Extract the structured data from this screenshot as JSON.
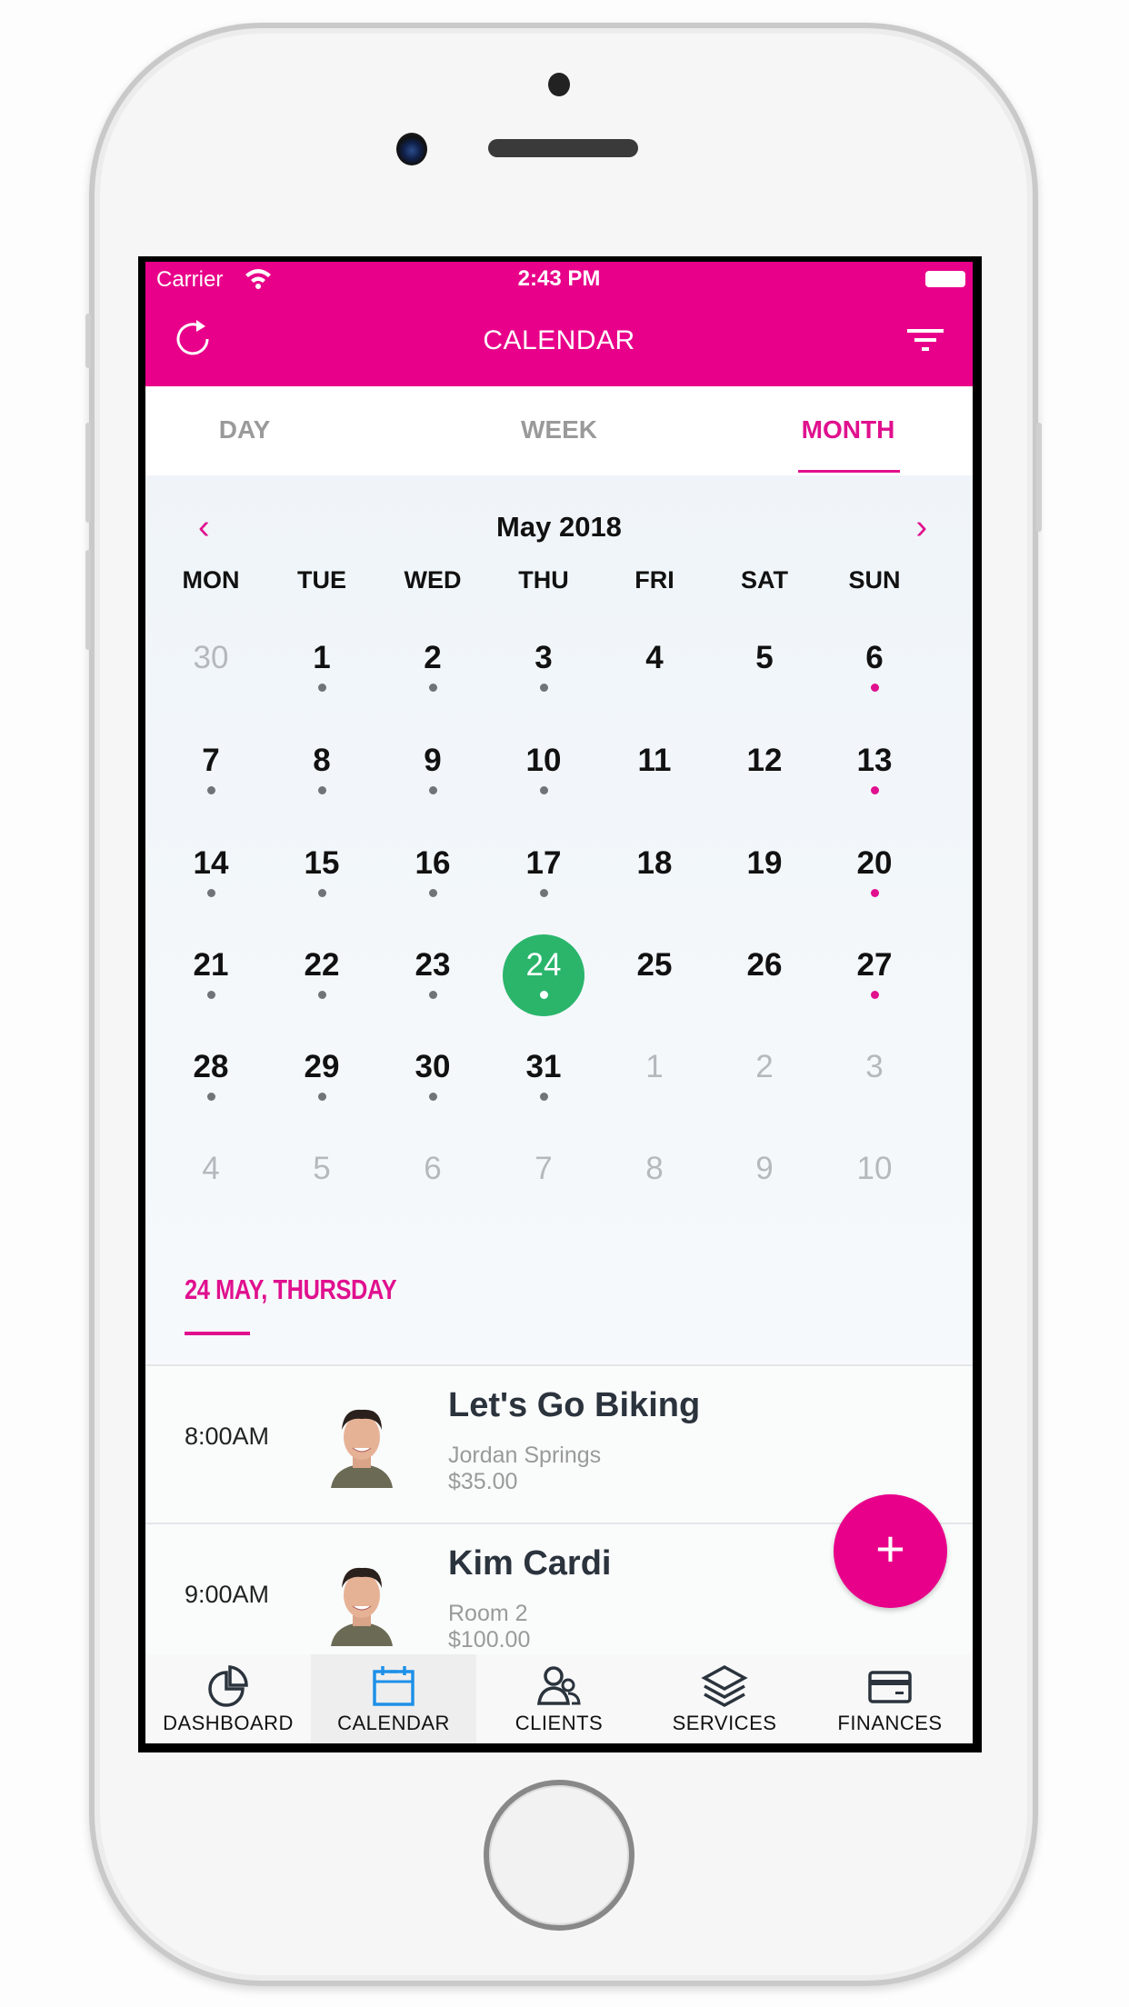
{
  "status_bar": {
    "carrier": "Carrier",
    "time": "2:43 PM"
  },
  "nav": {
    "title": "CALENDAR",
    "left_icon": "refresh-icon",
    "right_icon": "filter-icon"
  },
  "tabs": [
    {
      "label": "DAY",
      "active": false
    },
    {
      "label": "WEEK",
      "active": false
    },
    {
      "label": "MONTH",
      "active": true
    }
  ],
  "calendar": {
    "month_label": "May 2018",
    "prev_icon": "chevron-left-icon",
    "next_icon": "chevron-right-icon",
    "weekdays": [
      "MON",
      "TUE",
      "WED",
      "THU",
      "FRI",
      "SAT",
      "SUN"
    ],
    "selected_day": 24,
    "weeks": [
      [
        {
          "d": "30",
          "m": true,
          "dot": null
        },
        {
          "d": "1",
          "dot": "gray"
        },
        {
          "d": "2",
          "dot": "gray"
        },
        {
          "d": "3",
          "dot": "gray"
        },
        {
          "d": "4",
          "dot": null
        },
        {
          "d": "5",
          "dot": null
        },
        {
          "d": "6",
          "dot": "pink"
        }
      ],
      [
        {
          "d": "7",
          "dot": "gray"
        },
        {
          "d": "8",
          "dot": "gray"
        },
        {
          "d": "9",
          "dot": "gray"
        },
        {
          "d": "10",
          "dot": "gray"
        },
        {
          "d": "11",
          "dot": null
        },
        {
          "d": "12",
          "dot": null
        },
        {
          "d": "13",
          "dot": "pink"
        }
      ],
      [
        {
          "d": "14",
          "dot": "gray"
        },
        {
          "d": "15",
          "dot": "gray"
        },
        {
          "d": "16",
          "dot": "gray"
        },
        {
          "d": "17",
          "dot": "gray"
        },
        {
          "d": "18",
          "dot": null
        },
        {
          "d": "19",
          "dot": null
        },
        {
          "d": "20",
          "dot": "pink"
        }
      ],
      [
        {
          "d": "21",
          "dot": "gray"
        },
        {
          "d": "22",
          "dot": "gray"
        },
        {
          "d": "23",
          "dot": "gray"
        },
        {
          "d": "24",
          "dot": "white",
          "sel": true
        },
        {
          "d": "25",
          "dot": null
        },
        {
          "d": "26",
          "dot": null
        },
        {
          "d": "27",
          "dot": "pink"
        }
      ],
      [
        {
          "d": "28",
          "dot": "gray"
        },
        {
          "d": "29",
          "dot": "gray"
        },
        {
          "d": "30",
          "dot": "gray"
        },
        {
          "d": "31",
          "dot": "gray"
        },
        {
          "d": "1",
          "m": true,
          "dot": null
        },
        {
          "d": "2",
          "m": true,
          "dot": null
        },
        {
          "d": "3",
          "m": true,
          "dot": null
        }
      ],
      [
        {
          "d": "4",
          "m": true,
          "dot": null
        },
        {
          "d": "5",
          "m": true,
          "dot": null
        },
        {
          "d": "6",
          "m": true,
          "dot": null
        },
        {
          "d": "7",
          "m": true,
          "dot": null
        },
        {
          "d": "8",
          "m": true,
          "dot": null
        },
        {
          "d": "9",
          "m": true,
          "dot": null
        },
        {
          "d": "10",
          "m": true,
          "dot": null
        }
      ]
    ]
  },
  "agenda": {
    "date_label": "24 MAY, THURSDAY",
    "appointments": [
      {
        "time": "8:00AM",
        "title": "Let's Go Biking",
        "location": "Jordan Springs",
        "price": "$35.00"
      },
      {
        "time": "9:00AM",
        "title": "Kim Cardi",
        "location": "Room 2",
        "price": "$100.00"
      }
    ]
  },
  "fab": {
    "label": "+"
  },
  "bottom_nav": [
    {
      "label": "DASHBOARD",
      "icon": "pie-chart-icon",
      "active": false
    },
    {
      "label": "CALENDAR",
      "icon": "calendar-icon",
      "active": true
    },
    {
      "label": "CLIENTS",
      "icon": "users-icon",
      "active": false
    },
    {
      "label": "SERVICES",
      "icon": "layers-icon",
      "active": false
    },
    {
      "label": "FINANCES",
      "icon": "credit-card-icon",
      "active": false
    }
  ],
  "colors": {
    "brand": "#e8008a",
    "selected_day": "#2ab56b",
    "active_nav": "#1e90e8",
    "dot_gray": "#707478",
    "dot_pink": "#e0108e"
  }
}
